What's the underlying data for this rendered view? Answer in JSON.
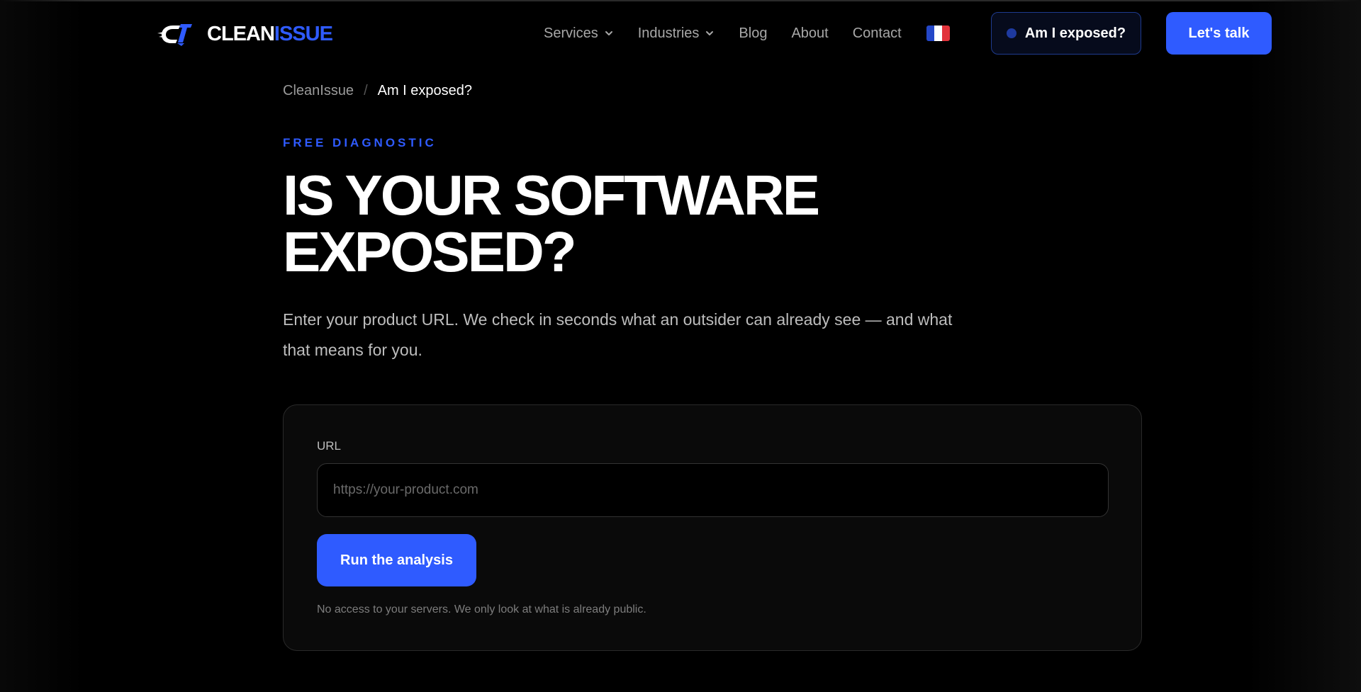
{
  "header": {
    "logo": {
      "part1": "CLEAN",
      "part2": "ISSUE",
      "icon": "cleanissue-logo-icon"
    },
    "nav": [
      {
        "label": "Services",
        "has_dropdown": true
      },
      {
        "label": "Industries",
        "has_dropdown": true
      },
      {
        "label": "Blog",
        "has_dropdown": false
      },
      {
        "label": "About",
        "has_dropdown": false
      },
      {
        "label": "Contact",
        "has_dropdown": false
      }
    ],
    "language_icon": "france-flag-icon",
    "exposed_button": "Am I exposed?",
    "talk_button": "Let's talk"
  },
  "breadcrumb": {
    "home": "CleanIssue",
    "separator": "/",
    "current": "Am I exposed?"
  },
  "hero": {
    "eyebrow": "FREE DIAGNOSTIC",
    "title_line1": "IS YOUR SOFTWARE",
    "title_line2": "EXPOSED?",
    "subtitle": "Enter your product URL. We check in seconds what an outsider can already see — and what that means for you."
  },
  "form": {
    "label": "URL",
    "value": "",
    "placeholder": "https://your-product.com",
    "submit": "Run the analysis",
    "note": "No access to your servers. We only look at what is already public."
  },
  "colors": {
    "accent": "#2f5bff",
    "background": "#000000",
    "card_background": "#0a0a0a"
  }
}
